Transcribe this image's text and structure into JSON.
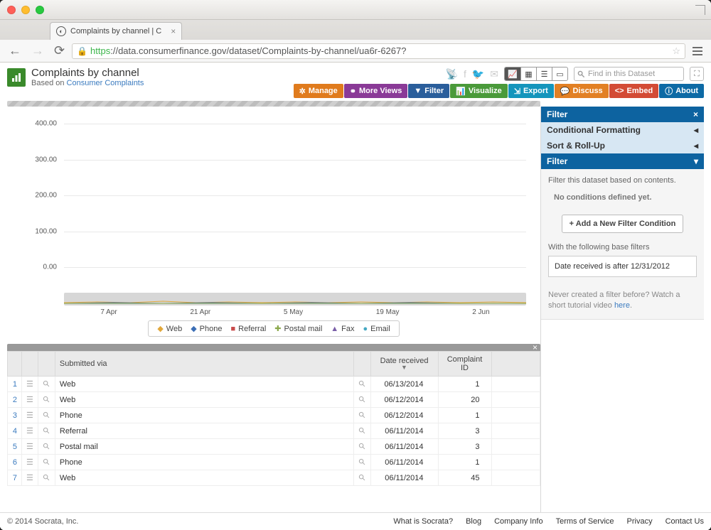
{
  "browser": {
    "tab_title": "Complaints by channel | C",
    "url_https": "https",
    "url_rest": "://data.consumerfinance.gov/dataset/Complaints-by-channel/ua6r-6267?"
  },
  "header": {
    "title": "Complaints by channel",
    "based_on_prefix": "Based on ",
    "based_on_link": "Consumer Complaints",
    "search_placeholder": "Find in this Dataset",
    "actions": {
      "manage": "Manage",
      "more_views": "More Views",
      "filter": "Filter",
      "visualize": "Visualize",
      "export": "Export",
      "discuss": "Discuss",
      "embed": "Embed",
      "about": "About"
    }
  },
  "chart_data": {
    "type": "line",
    "y_ticks": [
      "400.00",
      "300.00",
      "200.00",
      "100.00",
      "0.00"
    ],
    "x_ticks": [
      "7 Apr",
      "21 Apr",
      "5 May",
      "19 May",
      "2 Jun"
    ],
    "series": [
      {
        "name": "Web",
        "color": "#e2a83c"
      },
      {
        "name": "Phone",
        "color": "#3b6eb5"
      },
      {
        "name": "Referral",
        "color": "#c84b4b"
      },
      {
        "name": "Postal mail",
        "color": "#8aa84a"
      },
      {
        "name": "Fax",
        "color": "#7a5ea8"
      },
      {
        "name": "Email",
        "color": "#45a8c2"
      }
    ]
  },
  "table": {
    "headers": {
      "submitted": "Submitted via",
      "date": "Date received",
      "complaint": "Complaint ID"
    },
    "rows": [
      {
        "n": "1",
        "via": "Web",
        "date": "06/13/2014",
        "id": "1"
      },
      {
        "n": "2",
        "via": "Web",
        "date": "06/12/2014",
        "id": "20"
      },
      {
        "n": "3",
        "via": "Phone",
        "date": "06/12/2014",
        "id": "1"
      },
      {
        "n": "4",
        "via": "Referral",
        "date": "06/11/2014",
        "id": "3"
      },
      {
        "n": "5",
        "via": "Postal mail",
        "date": "06/11/2014",
        "id": "3"
      },
      {
        "n": "6",
        "via": "Phone",
        "date": "06/11/2014",
        "id": "1"
      },
      {
        "n": "7",
        "via": "Web",
        "date": "06/11/2014",
        "id": "45"
      }
    ]
  },
  "side": {
    "panel_title": "Filter",
    "cond_fmt": "Conditional Formatting",
    "sort_roll": "Sort & Roll-Up",
    "filter_sub": "Filter",
    "desc": "Filter this dataset based on contents.",
    "no_cond": "No conditions defined yet.",
    "add_btn": "Add a New Filter Condition",
    "base_label": "With the following base filters",
    "base_filter": "Date received is after 12/31/2012",
    "tutorial_prefix": "Never created a filter before? Watch a short tutorial video ",
    "tutorial_link": "here"
  },
  "footer": {
    "copyright": "© 2014 Socrata, Inc.",
    "links": [
      "What is Socrata?",
      "Blog",
      "Company Info",
      "Terms of Service",
      "Privacy",
      "Contact Us"
    ]
  }
}
